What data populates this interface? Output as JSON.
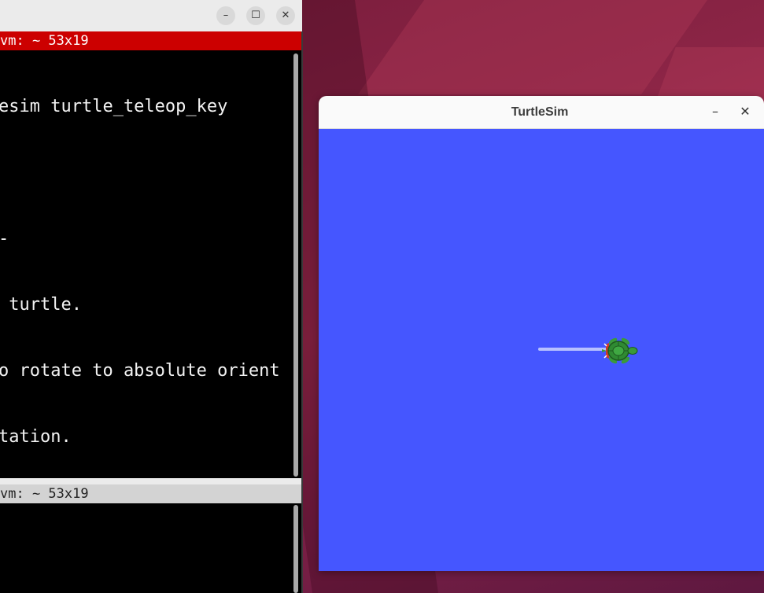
{
  "terminal": {
    "active_tab_title": "vm: ~ 53x19",
    "inactive_tab_title": "vm: ~ 53x19",
    "lines": [
      "esim turtle_teleop_key",
      "",
      "-",
      " turtle.",
      "o rotate to absolute orient",
      "tation."
    ],
    "buttons": {
      "minimize": "–",
      "maximize": "☐",
      "close": "✕"
    }
  },
  "turtlesim": {
    "title": "TurtleSim",
    "buttons": {
      "minimize": "–",
      "close": "✕"
    },
    "background_color": "#4556ff"
  },
  "colors": {
    "terminal_active_tab": "#cc0000",
    "wallpaper": "#8a2445"
  }
}
